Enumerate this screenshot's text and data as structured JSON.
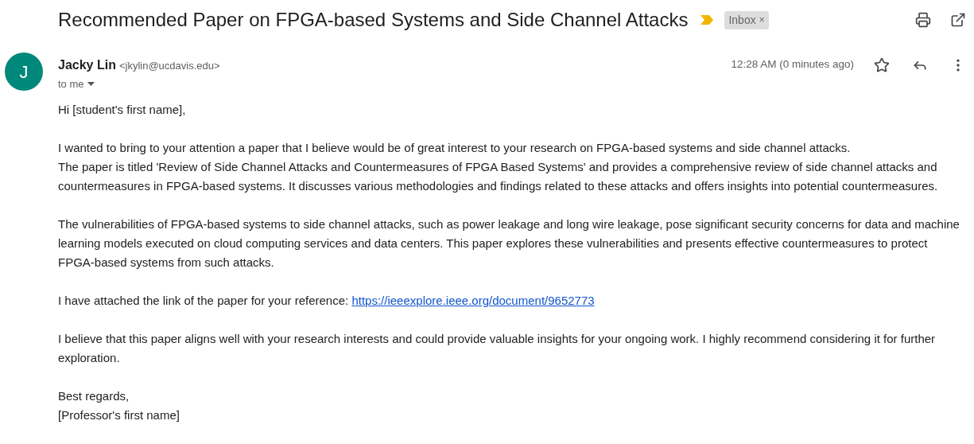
{
  "subject": "Recommended Paper on FPGA-based Systems and Side Channel Attacks",
  "important": true,
  "labels": [
    {
      "text": "Inbox",
      "close": "×"
    }
  ],
  "message": {
    "avatar": "J",
    "sender_name": "Jacky Lin",
    "sender_email": "<jkylin@ucdavis.edu>",
    "recipient": "to me",
    "time": "12:28 AM (0 minutes ago)",
    "starred": false,
    "body": [
      {
        "lines": [
          "Hi [student's first name],"
        ]
      },
      {
        "lines": [
          "I wanted to bring to your attention a paper that I believe would be of great interest to your research on FPGA-based systems and side channel attacks.",
          "The paper is titled 'Review of Side Channel Attacks and Countermeasures of FPGA Based Systems' and provides a comprehensive review of side channel attacks and countermeasures in FPGA-based systems. It discusses various methodologies and findings related to these attacks and offers insights into potential countermeasures."
        ]
      },
      {
        "lines": [
          "The vulnerabilities of FPGA-based systems to side channel attacks, such as power leakage and long wire leakage, pose significant security concerns for data and machine learning models executed on cloud computing services and data centers. This paper explores these vulnerabilities and presents effective countermeasures to protect FPGA-based systems from such attacks."
        ]
      },
      {
        "lines": [
          "I have attached the link of the paper for your reference:"
        ],
        "link": "https://ieeexplore.ieee.org/document/9652773"
      },
      {
        "lines": [
          "I believe that this paper aligns well with your research interests and could provide valuable insights for your ongoing work. I highly recommend considering it for further exploration."
        ]
      },
      {
        "lines": [
          "Best regards,",
          "[Professor's first name]"
        ]
      }
    ]
  }
}
